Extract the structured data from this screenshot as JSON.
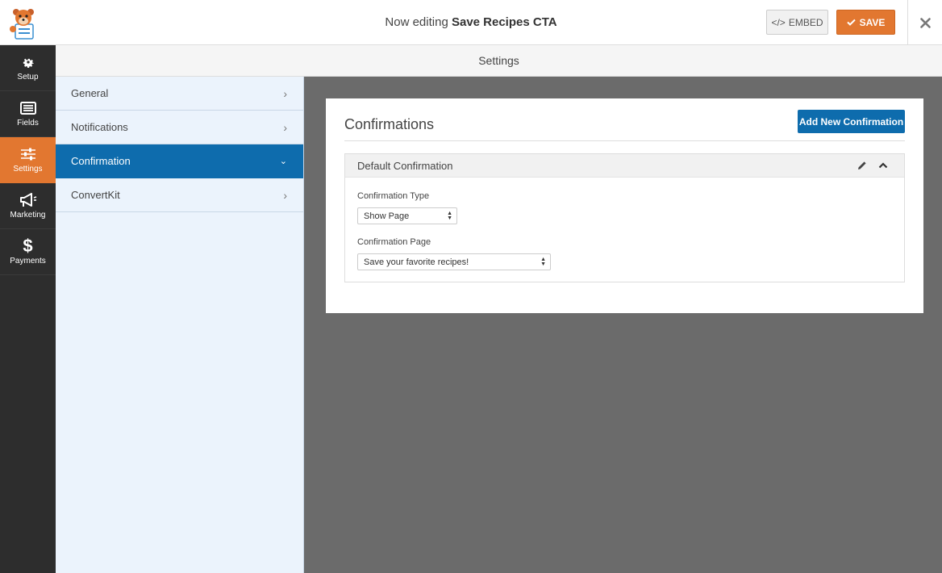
{
  "header": {
    "title_prefix": "Now editing",
    "form_name": "Save Recipes CTA",
    "embed_label": "EMBED",
    "save_label": "SAVE"
  },
  "rail": {
    "items": [
      {
        "label": "Setup",
        "icon": "gear-icon"
      },
      {
        "label": "Fields",
        "icon": "list-icon"
      },
      {
        "label": "Settings",
        "icon": "sliders-icon"
      },
      {
        "label": "Marketing",
        "icon": "megaphone-icon"
      },
      {
        "label": "Payments",
        "icon": "dollar-icon"
      }
    ]
  },
  "settings_bar": {
    "title": "Settings"
  },
  "panel": {
    "items": [
      {
        "label": "General"
      },
      {
        "label": "Notifications"
      },
      {
        "label": "Confirmation"
      },
      {
        "label": "ConvertKit"
      }
    ]
  },
  "confirmations": {
    "title": "Confirmations",
    "add_label": "Add New Confirmation",
    "default": {
      "title": "Default Confirmation",
      "type_label": "Confirmation Type",
      "type_value": "Show Page",
      "page_label": "Confirmation Page",
      "page_value": "Save your favorite recipes!"
    }
  },
  "colors": {
    "accent_orange": "#e27730",
    "accent_blue": "#0e6cad",
    "rail_bg": "#2d2d2d",
    "canvas_bg": "#6b6b6b"
  }
}
